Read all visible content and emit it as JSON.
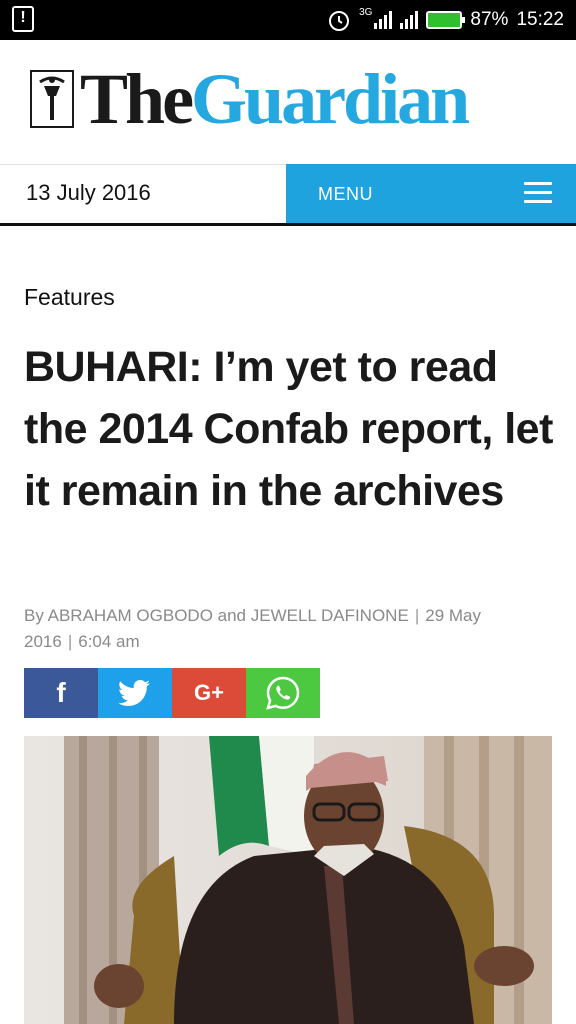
{
  "status_bar": {
    "network": "3G",
    "battery": "87%",
    "time": "15:22"
  },
  "masthead": {
    "logo_the": "The",
    "logo_guardian": "Guardian"
  },
  "nav": {
    "date": "13 July 2016",
    "menu_label": "MENU"
  },
  "article": {
    "section": "Features",
    "headline": "BUHARI: I’m yet to read the 2014 Confab report, let it remain in the archives",
    "byline_authors": "By ABRAHAM OGBODO and JEWELL DAFINONE",
    "byline_date": "29 May 2016",
    "byline_time": "6:04 am",
    "separator": "|"
  },
  "share": {
    "facebook_glyph": "f",
    "googleplus_glyph": "G+"
  },
  "colors": {
    "brand_blue": "#1fa3df",
    "facebook": "#3b5998",
    "twitter": "#1ea0ea",
    "googleplus": "#dc4a38",
    "whatsapp": "#4cc940"
  },
  "icons": [
    "alert-icon",
    "alarm-icon",
    "signal-icon",
    "battery-icon",
    "hamburger-icon",
    "facebook-icon",
    "twitter-icon",
    "google-plus-icon",
    "whatsapp-icon"
  ]
}
